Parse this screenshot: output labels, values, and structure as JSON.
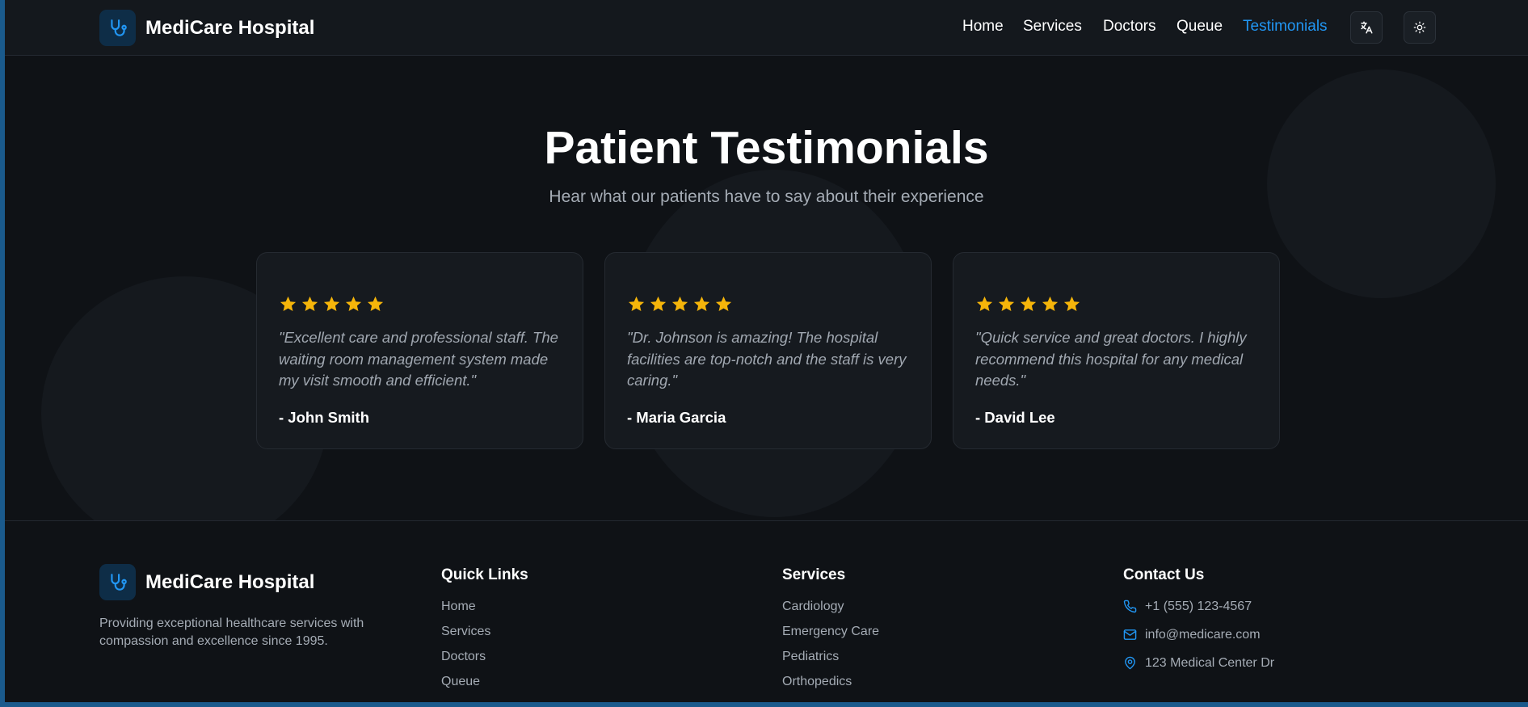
{
  "header": {
    "brand": "MediCare Hospital",
    "nav": [
      {
        "label": "Home",
        "active": false
      },
      {
        "label": "Services",
        "active": false
      },
      {
        "label": "Doctors",
        "active": false
      },
      {
        "label": "Queue",
        "active": false
      },
      {
        "label": "Testimonials",
        "active": true
      }
    ],
    "language_icon": "translate-icon",
    "theme_icon": "sun-icon"
  },
  "hero": {
    "title": "Patient Testimonials",
    "subtitle": "Hear what our patients have to say about their experience"
  },
  "testimonials": [
    {
      "rating": 5,
      "quote": "\"Excellent care and professional staff. The waiting room management system made my visit smooth and efficient.\"",
      "author": "- John Smith"
    },
    {
      "rating": 5,
      "quote": "\"Dr. Johnson is amazing! The hospital facilities are top-notch and the staff is very caring.\"",
      "author": "- Maria Garcia"
    },
    {
      "rating": 5,
      "quote": "\"Quick service and great doctors. I highly recommend this hospital for any medical needs.\"",
      "author": "- David Lee"
    }
  ],
  "footer": {
    "brand": "MediCare Hospital",
    "description": "Providing exceptional healthcare services with compassion and excellence since 1995.",
    "quick_links": {
      "title": "Quick Links",
      "items": [
        "Home",
        "Services",
        "Doctors",
        "Queue"
      ]
    },
    "services": {
      "title": "Services",
      "items": [
        "Cardiology",
        "Emergency Care",
        "Pediatrics",
        "Orthopedics"
      ]
    },
    "contact": {
      "title": "Contact Us",
      "phone": "+1 (555) 123-4567",
      "email": "info@medicare.com",
      "address": "123 Medical Center Dr"
    }
  },
  "colors": {
    "accent": "#2196f3",
    "star": "#f5b50a",
    "background": "#0f1216",
    "card": "#161a1f"
  }
}
